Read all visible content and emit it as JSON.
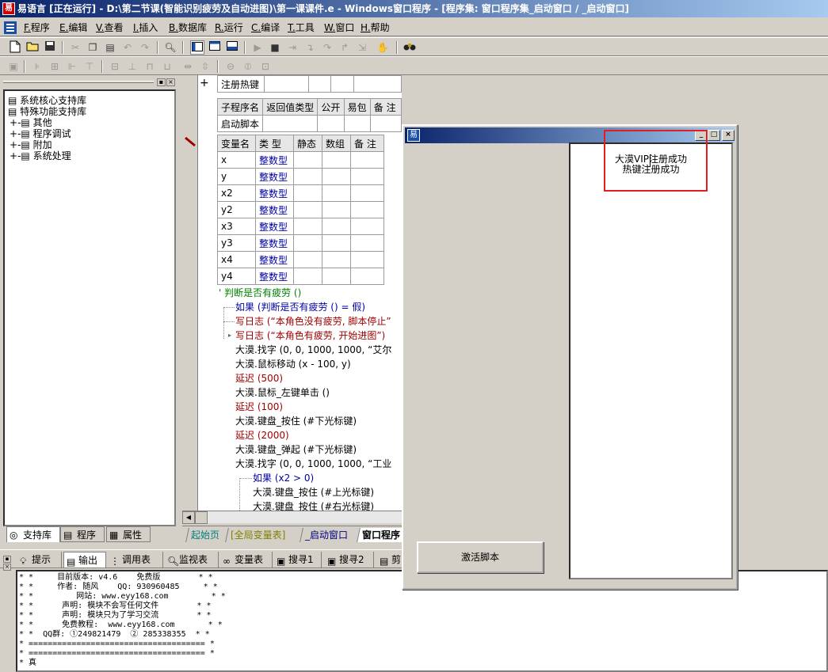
{
  "window": {
    "title": "易语言 [正在运行] - D:\\第二节课(智能识别疲劳及自动进图)\\第一课课件.e - Windows窗口程序 - [程序集: 窗口程序集_启动窗口 / _启动窗口]",
    "app_icon_glyph": "易"
  },
  "menu": [
    {
      "key": "F.",
      "label": "程序"
    },
    {
      "key": "E.",
      "label": "编辑"
    },
    {
      "key": "V.",
      "label": "查看"
    },
    {
      "key": "I.",
      "label": "插入"
    },
    {
      "key": "B.",
      "label": "数据库"
    },
    {
      "key": "R.",
      "label": "运行"
    },
    {
      "key": "C.",
      "label": "编译"
    },
    {
      "key": "T.",
      "label": "工具"
    },
    {
      "key": "W.",
      "label": "窗口"
    },
    {
      "key": "H.",
      "label": "帮助"
    }
  ],
  "toolbar1": [
    "new-file-icon",
    "open-icon",
    "save-icon",
    "cut-icon",
    "copy-icon",
    "paste-icon",
    "undo-icon",
    "redo-icon",
    "find-icon",
    "layout1-icon",
    "layout2-icon",
    "layout3-icon",
    "run-icon",
    "stop-icon",
    "step-icon",
    "step-into-icon",
    "step-over-icon",
    "step-out-icon",
    "run-to-icon",
    "hand-icon",
    "binoculars-icon"
  ],
  "left_panel": {
    "tree": [
      {
        "label": "系统核心支持库",
        "level": 0,
        "expander": ""
      },
      {
        "label": "特殊功能支持库",
        "level": 0,
        "expander": ""
      },
      {
        "label": "其他",
        "level": 1,
        "expander": "+"
      },
      {
        "label": "程序调试",
        "level": 1,
        "expander": "+"
      },
      {
        "label": "附加",
        "level": 1,
        "expander": "+"
      },
      {
        "label": "系统处理",
        "level": 1,
        "expander": "+"
      }
    ],
    "tabs": [
      {
        "label": "支持库"
      },
      {
        "label": "程序"
      },
      {
        "label": "属性"
      }
    ]
  },
  "editor": {
    "hotkey_row": {
      "col1": "注册热键"
    },
    "sub_header": [
      "子程序名",
      "返回值类型",
      "公开",
      "易包",
      "备 注"
    ],
    "sub_row": [
      "启动脚本",
      "",
      "",
      "",
      ""
    ],
    "var_header": [
      "变量名",
      "类 型",
      "静态",
      "数组",
      "备 注"
    ],
    "vars": [
      {
        "name": "x",
        "type": "整数型"
      },
      {
        "name": "y",
        "type": "整数型"
      },
      {
        "name": "x2",
        "type": "整数型"
      },
      {
        "name": "y2",
        "type": "整数型"
      },
      {
        "name": "x3",
        "type": "整数型"
      },
      {
        "name": "y3",
        "type": "整数型"
      },
      {
        "name": "x4",
        "type": "整数型"
      },
      {
        "name": "y4",
        "type": "整数型"
      }
    ],
    "code": [
      "' 判断是否有疲劳 ()",
      "如果 (判断是否有疲劳 () = 假)",
      "写日志 (“本角色没有疲劳, 脚本停止”",
      "写日志 (“本角色有疲劳, 开始进图”)",
      "大漠.找字 (0, 0, 1000, 1000, “艾尔",
      "大漠.鼠标移动 (x - 100, y)",
      "延迟 (500)",
      "大漠.鼠标_左键单击 ()",
      "延迟 (100)",
      "大漠.键盘_按住 (#下光标键)",
      "延迟 (2000)",
      "大漠.键盘_弹起 (#下光标键)",
      "大漠.找字 (0, 0, 1000, 1000, “工业",
      "如果 (x2 > 0)",
      "大漠.键盘_按住 (#上光标键)",
      "大漠.键盘_按住 (#右光标键)"
    ]
  },
  "editor_tabs": [
    {
      "label": "起始页"
    },
    {
      "label": "[全局变量表]"
    },
    {
      "label": "_启动窗口"
    },
    {
      "label": "窗口程序"
    }
  ],
  "output_tabs": [
    {
      "label": "提示",
      "icon": "hint-icon"
    },
    {
      "label": "输出",
      "icon": "output-icon"
    },
    {
      "label": "调用表",
      "icon": "callstack-icon"
    },
    {
      "label": "监视表",
      "icon": "watch-icon"
    },
    {
      "label": "变量表",
      "icon": "vars-icon"
    },
    {
      "label": "搜寻1",
      "icon": "search1-icon"
    },
    {
      "label": "搜寻2",
      "icon": "search2-icon"
    },
    {
      "label": "剪",
      "icon": "clip-icon"
    }
  ],
  "output_text": "* *     目前版本: v4.6    免费版        * *\n* *     作者: 随风    QQ: 930960485     * *\n* *         网站: www.eyy168.com         * *\n* *      声明: 模块不会写任何文件        * *\n* *      声明: 模块只为了学习交流        * *\n* *      免费教程:  www.eyy168.com       * *\n* *  QQ群: ①249821479  ② 285338355  * *\n* ===================================== *\n* ===================================== *\n* 真",
  "running_window": {
    "icon_glyph": "易",
    "list_items": [
      "大漠VIP注册成功",
      "热键注册成功"
    ],
    "button_label": "激活脚本"
  },
  "colors": {
    "titlebar_start": "#0a246a",
    "titlebar_end": "#a6caf0",
    "highlight_box": "#e02020",
    "type_blue": "#0000a0",
    "comment_green": "#008000"
  }
}
